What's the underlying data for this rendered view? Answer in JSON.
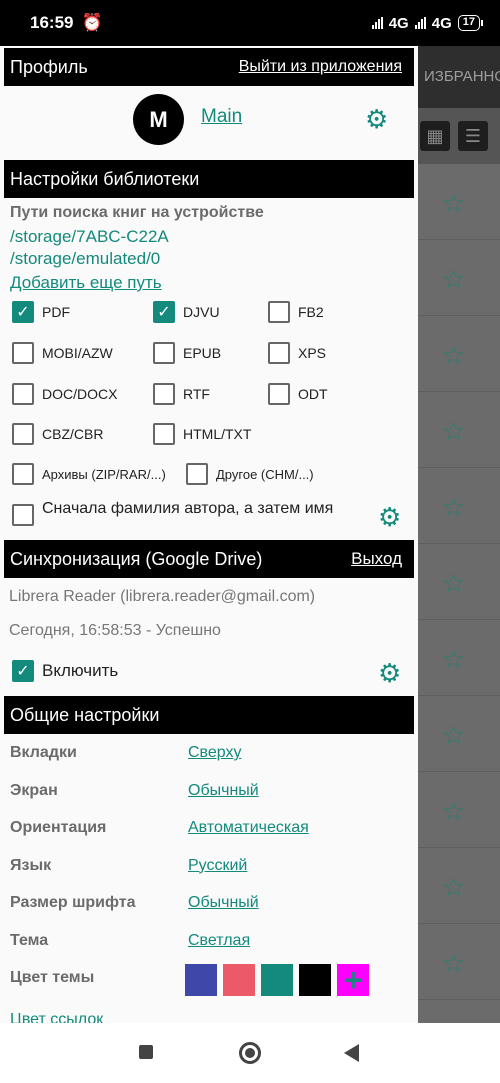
{
  "status": {
    "time": "16:59",
    "net1": "4G",
    "net2": "4G",
    "battery": "17"
  },
  "background": {
    "tab_label": "ИЗБРАННО"
  },
  "profile": {
    "header_title": "Профиль",
    "logout_link": "Выйти из приложения",
    "avatar_letter": "M",
    "name": "Main"
  },
  "library": {
    "header_title": "Настройки библиотеки",
    "paths_title": "Пути поиска книг на устройстве",
    "paths": [
      "/storage/7ABC-C22A",
      "/storage/emulated/0"
    ],
    "add_path": "Добавить еще путь",
    "formats": [
      {
        "label": "PDF",
        "checked": true
      },
      {
        "label": "DJVU",
        "checked": true
      },
      {
        "label": "FB2",
        "checked": false
      },
      {
        "label": "MOBI/AZW",
        "checked": false
      },
      {
        "label": "EPUB",
        "checked": false
      },
      {
        "label": "XPS",
        "checked": false
      },
      {
        "label": "DOC/DOCX",
        "checked": false
      },
      {
        "label": "RTF",
        "checked": false
      },
      {
        "label": "ODT",
        "checked": false
      },
      {
        "label": "CBZ/CBR",
        "checked": false
      },
      {
        "label": "HTML/TXT",
        "checked": false
      },
      {
        "label": "Архивы (ZIP/RAR/...)",
        "checked": false
      },
      {
        "label": "Другое (CHM/...)",
        "checked": false
      }
    ],
    "author_first": "Сначала фамилия автора, а затем имя"
  },
  "sync": {
    "header_title": "Синхронизация (Google Drive)",
    "exit_link": "Выход",
    "account": "Librera Reader (librera.reader@gmail.com)",
    "last_sync": "Сегодня, 16:58:53 - Успешно",
    "enable_label": "Включить",
    "enabled": true
  },
  "general": {
    "header_title": "Общие настройки",
    "settings": [
      {
        "key": "Вкладки",
        "value": "Сверху"
      },
      {
        "key": "Экран",
        "value": "Обычный"
      },
      {
        "key": "Ориентация",
        "value": "Автоматическая"
      },
      {
        "key": "Язык",
        "value": "Русский"
      },
      {
        "key": "Размер шрифта",
        "value": "Обычный"
      },
      {
        "key": "Тема",
        "value": "Светлая"
      }
    ],
    "theme_color_label": "Цвет темы",
    "theme_colors": [
      "#3f48a8",
      "#ec5a6a",
      "#138a7c",
      "#000000",
      "#ff00ff"
    ],
    "link_color_label": "Цвет ссылок"
  }
}
